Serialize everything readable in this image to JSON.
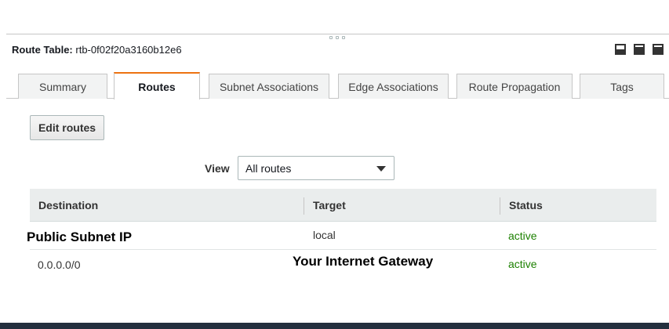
{
  "panel": {
    "title_label": "Route Table:",
    "route_table_id": "rtb-0f02f20a3160b12e6"
  },
  "tabs": [
    {
      "label": "Summary",
      "active": false
    },
    {
      "label": "Routes",
      "active": true
    },
    {
      "label": "Subnet Associations",
      "active": false
    },
    {
      "label": "Edge Associations",
      "active": false
    },
    {
      "label": "Route Propagation",
      "active": false
    },
    {
      "label": "Tags",
      "active": false
    }
  ],
  "toolbar": {
    "edit_routes_label": "Edit routes"
  },
  "filter": {
    "view_label": "View",
    "view_value": "All routes"
  },
  "table": {
    "columns": [
      "Destination",
      "Target",
      "Status"
    ],
    "rows": [
      {
        "destination": "Public Subnet IP",
        "target": "local",
        "status": "active"
      },
      {
        "destination": "0.0.0.0/0",
        "target": "Your Internet Gateway",
        "status": "active"
      }
    ]
  },
  "colors": {
    "active_tab_accent": "#ec7211",
    "status_active": "#1d8102",
    "footer": "#232f3e"
  },
  "icons": [
    "drag-handle-icon",
    "layout-bottom-icon",
    "layout-half-icon",
    "layout-full-icon",
    "caret-down-icon"
  ]
}
